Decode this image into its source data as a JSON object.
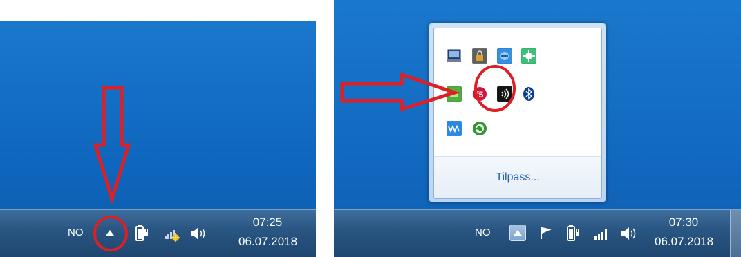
{
  "left_screenshot": {
    "language_indicator": "NO",
    "clock": {
      "time": "07:25",
      "date": "06.07.2018"
    },
    "tray_icons": [
      "show-hidden-icons-arrow-icon",
      "battery-power-icon",
      "network-signal-warning-icon",
      "speaker-volume-icon"
    ]
  },
  "right_screenshot": {
    "language_indicator": "NO",
    "clock": {
      "time": "07:30",
      "date": "06.07.2018"
    },
    "tray_icons": [
      "show-hidden-icons-button-icon",
      "action-center-flag-icon",
      "battery-power-icon",
      "network-signal-icon",
      "speaker-volume-icon"
    ],
    "hidden_icons_popup": {
      "icons": [
        "monitor-app-icon",
        "lock-app-icon",
        "network-app-icon",
        "green-app-icon",
        "green-app-icon-2",
        "f5-vpn-icon",
        "wireless-app-icon",
        "bluetooth-icon",
        "waves-app-icon",
        "sync-app-icon"
      ],
      "customize_link": "Tilpass..."
    }
  },
  "colors": {
    "desktop_blue": "#1269c0",
    "taskbar": "#2a5683",
    "annotation_red": "#dd1f26",
    "link_blue": "#1e5fb0"
  }
}
